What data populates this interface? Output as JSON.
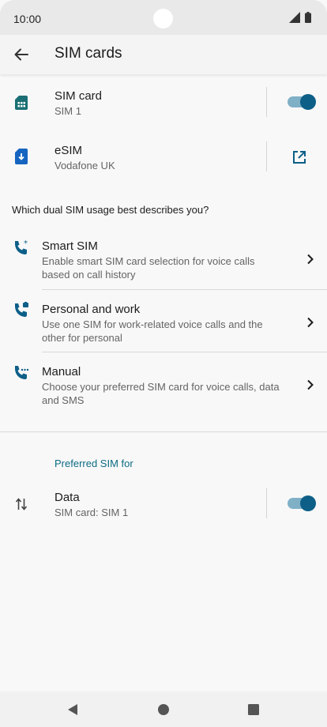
{
  "status_bar": {
    "time": "10:00"
  },
  "app_bar": {
    "title": "SIM cards"
  },
  "sims": [
    {
      "title": "SIM card",
      "subtitle": "SIM 1",
      "toggle_on": true
    },
    {
      "title": "eSIM",
      "subtitle": "Vodafone UK"
    }
  ],
  "dual_sim": {
    "question": "Which dual SIM usage best describes you?",
    "options": [
      {
        "title": "Smart SIM",
        "line1": "Enable smart SIM card selection for voice calls",
        "line2": "based on call history"
      },
      {
        "title": "Personal and work",
        "line1": "Use one SIM for work-related voice calls and the",
        "line2": "other for personal"
      },
      {
        "title": "Manual",
        "line1": "Choose your preferred SIM card for voice calls, data",
        "line2": "and SMS"
      }
    ]
  },
  "preferred": {
    "header": "Preferred SIM for",
    "data": {
      "title": "Data",
      "subtitle": "SIM card: SIM 1",
      "toggle_on": true
    }
  },
  "colors": {
    "accent": "#0d5f88",
    "accent_track": "#7fb0c6",
    "header_text": "#0d6b84",
    "icon_teal": "#1a6f74",
    "icon_blue": "#1565c0"
  }
}
